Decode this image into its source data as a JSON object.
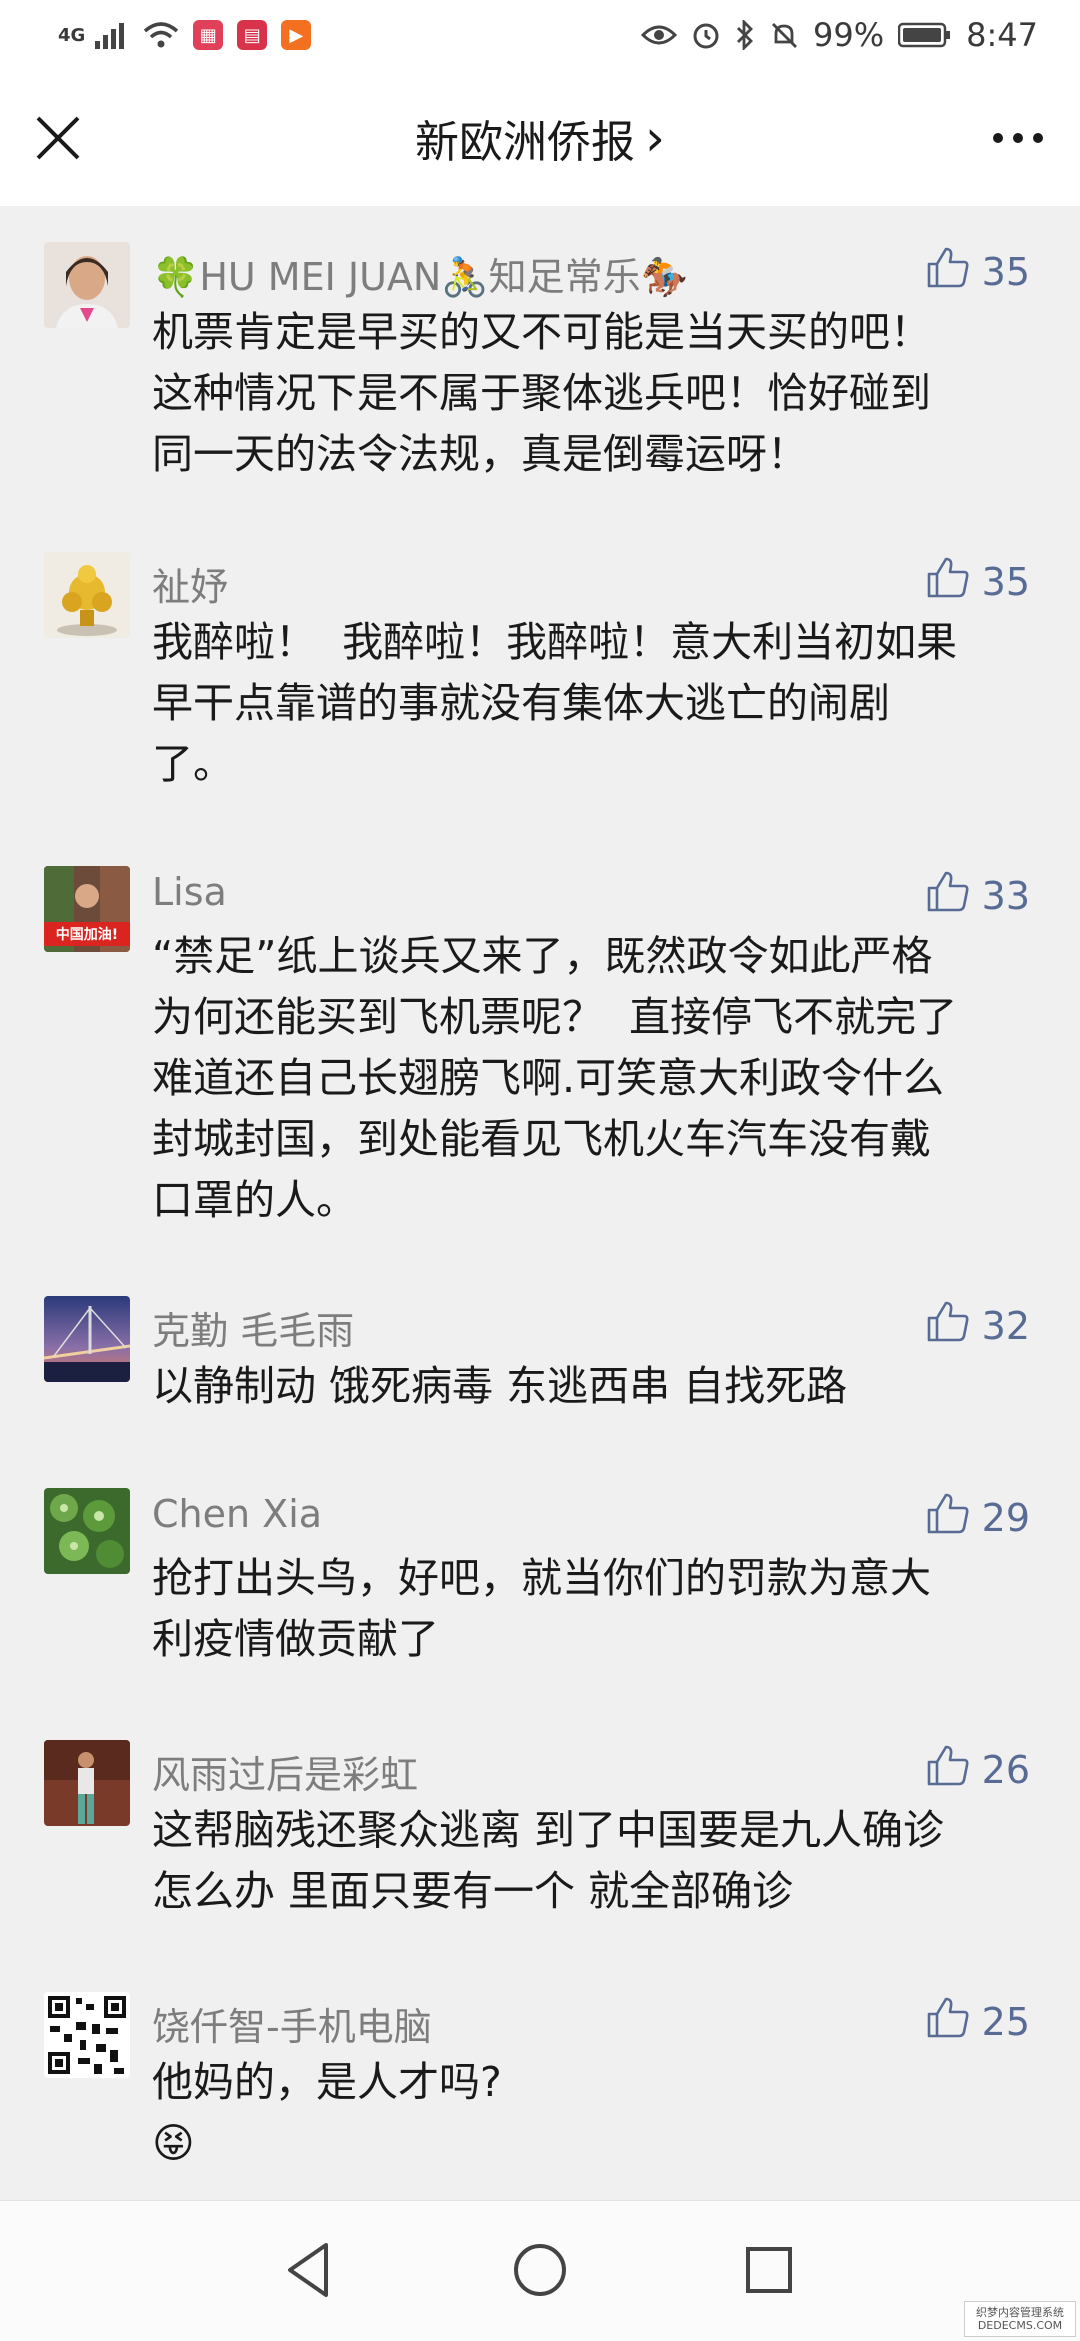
{
  "status_bar": {
    "network": "4G",
    "battery": "99%",
    "time": "8:47"
  },
  "nav": {
    "title": "新欧洲侨报",
    "chevron": "›"
  },
  "comments": [
    {
      "name": "🍀HU MEI JUAN🚴知足常乐🏇",
      "likes": "35",
      "text": "机票肯定是早买的又不可能是当天买的吧！\n这种情况下是不属于聚体逃兵吧！恰好碰到\n同一天的法令法规，真是倒霉运呀！"
    },
    {
      "name": "祉妤",
      "likes": "35",
      "text": "我醉啦！  我醉啦！我醉啦！意大利当初如果\n早干点靠谱的事就没有集体大逃亡的闹剧\n了。"
    },
    {
      "name": "Lisa",
      "likes": "33",
      "avatar_caption": "中国加油!",
      "text": "“禁足”纸上谈兵又来了，既然政令如此严格\n为何还能买到飞机票呢？  直接停飞不就完了\n难道还自己长翅膀飞啊.可笑意大利政令什么\n封城封国，到处能看见飞机火车汽车没有戴\n口罩的人。"
    },
    {
      "name": "克勤 毛毛雨",
      "likes": "32",
      "text": "以静制动 饿死病毒 东逃西串 自找死路"
    },
    {
      "name": "Chen Xia",
      "likes": "29",
      "text": "抢打出头鸟，好吧，就当你们的罚款为意大\n利疫情做贡献了"
    },
    {
      "name": "风雨过后是彩虹",
      "likes": "26",
      "text": "这帮脑残还聚众逃离 到了中国要是九人确诊\n怎么办 里面只要有一个 就全部确诊"
    },
    {
      "name": "饶仟智-手机电脑",
      "likes": "25",
      "text": "他妈的，是人才吗?\n😝"
    }
  ],
  "watermark": {
    "line1": "织梦内容管理系统",
    "line2": "DEDECMS.COM"
  }
}
